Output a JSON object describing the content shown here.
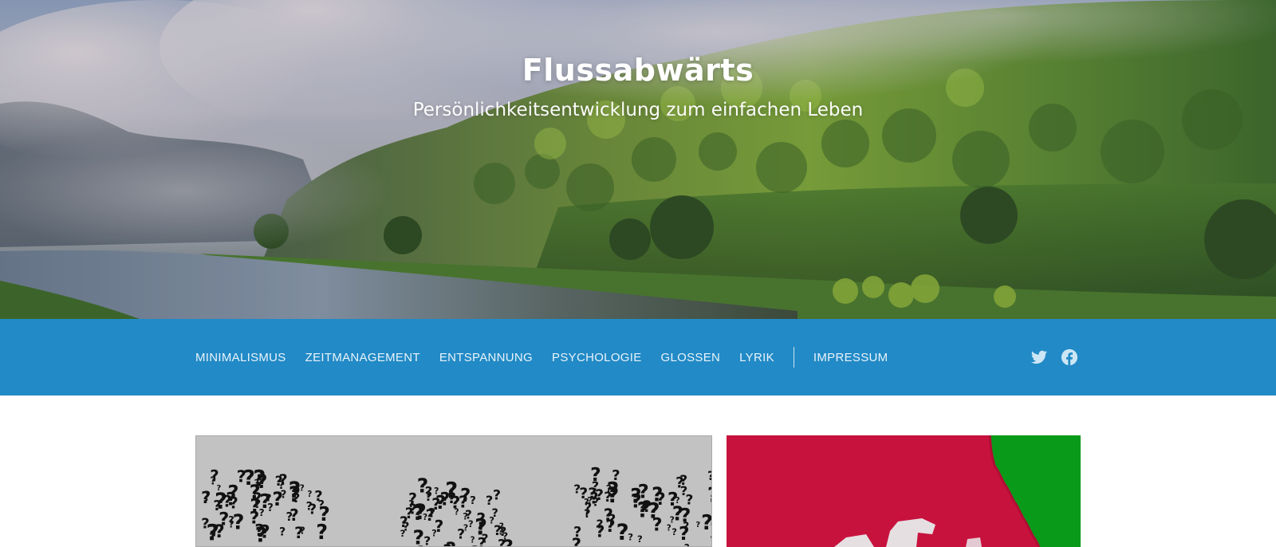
{
  "site": {
    "title": "Flussabwärts",
    "tagline": "Persönlichkeitsentwicklung zum einfachen Leben"
  },
  "nav": {
    "items": [
      {
        "label": "MINIMALISMUS"
      },
      {
        "label": "ZEITMANAGEMENT"
      },
      {
        "label": "ENTSPANNUNG"
      },
      {
        "label": "PSYCHOLOGIE"
      },
      {
        "label": "GLOSSEN"
      },
      {
        "label": "LYRIK"
      }
    ],
    "secondary": [
      {
        "label": "IMPRESSUM"
      }
    ],
    "social": [
      {
        "icon": "twitter-icon"
      },
      {
        "icon": "facebook-icon"
      }
    ]
  },
  "colors": {
    "nav_background": "#228ac6",
    "nav_text": "#e8f3fb",
    "card_right_red": "#c8123e",
    "card_right_green": "#0a9a1a",
    "card_left_gray": "#c2c2c2"
  },
  "posts": [
    {
      "image": "question-marks-image"
    },
    {
      "image": "red-stamp-image"
    }
  ]
}
